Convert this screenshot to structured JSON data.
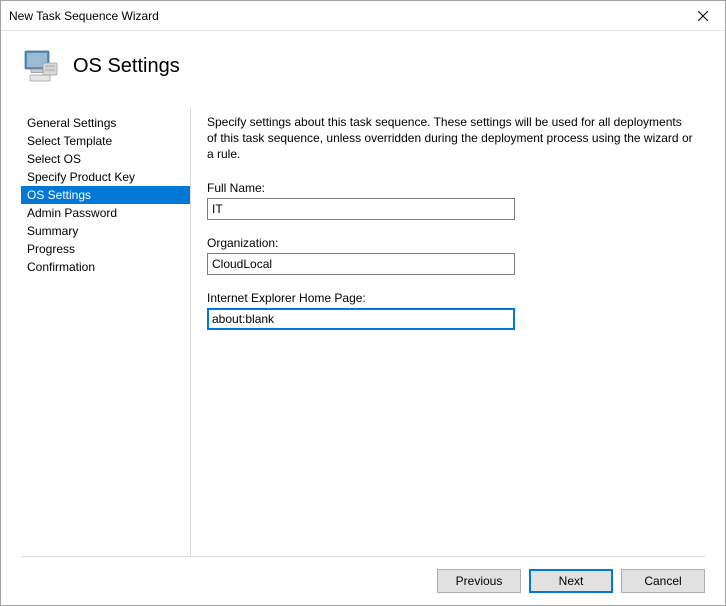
{
  "titlebar": {
    "title": "New Task Sequence Wizard"
  },
  "header": {
    "title": "OS Settings"
  },
  "sidebar": {
    "items": [
      {
        "label": "General Settings"
      },
      {
        "label": "Select Template"
      },
      {
        "label": "Select OS"
      },
      {
        "label": "Specify Product Key"
      },
      {
        "label": "OS Settings"
      },
      {
        "label": "Admin Password"
      },
      {
        "label": "Summary"
      },
      {
        "label": "Progress"
      },
      {
        "label": "Confirmation"
      }
    ],
    "selected_index": 4
  },
  "content": {
    "instruction": "Specify settings about this task sequence.  These settings will be used for all deployments of this task sequence, unless overridden during the deployment process using the wizard or a rule.",
    "fields": {
      "full_name": {
        "label": "Full Name:",
        "value": "IT"
      },
      "organization": {
        "label": "Organization:",
        "value": "CloudLocal"
      },
      "ie_home": {
        "label": "Internet Explorer Home Page:",
        "value": "about:blank"
      }
    }
  },
  "footer": {
    "previous": "Previous",
    "next": "Next",
    "cancel": "Cancel"
  }
}
